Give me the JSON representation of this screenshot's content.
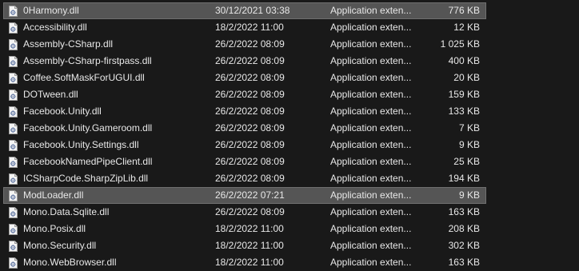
{
  "files": [
    {
      "name": "0Harmony.dll",
      "date": "30/12/2021 03:38",
      "type": "Application exten...",
      "size": "776 KB",
      "selected": true,
      "icon": "dll-file-icon"
    },
    {
      "name": "Accessibility.dll",
      "date": "18/2/2022 11:00",
      "type": "Application exten...",
      "size": "12 KB",
      "selected": false,
      "icon": "dll-file-icon"
    },
    {
      "name": "Assembly-CSharp.dll",
      "date": "26/2/2022 08:09",
      "type": "Application exten...",
      "size": "1 025 KB",
      "selected": false,
      "icon": "dll-file-icon"
    },
    {
      "name": "Assembly-CSharp-firstpass.dll",
      "date": "26/2/2022 08:09",
      "type": "Application exten...",
      "size": "400 KB",
      "selected": false,
      "icon": "dll-file-icon"
    },
    {
      "name": "Coffee.SoftMaskForUGUI.dll",
      "date": "26/2/2022 08:09",
      "type": "Application exten...",
      "size": "20 KB",
      "selected": false,
      "icon": "dll-file-icon"
    },
    {
      "name": "DOTween.dll",
      "date": "26/2/2022 08:09",
      "type": "Application exten...",
      "size": "159 KB",
      "selected": false,
      "icon": "dll-file-icon"
    },
    {
      "name": "Facebook.Unity.dll",
      "date": "26/2/2022 08:09",
      "type": "Application exten...",
      "size": "133 KB",
      "selected": false,
      "icon": "dll-file-icon"
    },
    {
      "name": "Facebook.Unity.Gameroom.dll",
      "date": "26/2/2022 08:09",
      "type": "Application exten...",
      "size": "7 KB",
      "selected": false,
      "icon": "dll-file-icon"
    },
    {
      "name": "Facebook.Unity.Settings.dll",
      "date": "26/2/2022 08:09",
      "type": "Application exten...",
      "size": "9 KB",
      "selected": false,
      "icon": "dll-file-icon"
    },
    {
      "name": "FacebookNamedPipeClient.dll",
      "date": "26/2/2022 08:09",
      "type": "Application exten...",
      "size": "25 KB",
      "selected": false,
      "icon": "dll-file-icon"
    },
    {
      "name": "ICSharpCode.SharpZipLib.dll",
      "date": "26/2/2022 08:09",
      "type": "Application exten...",
      "size": "194 KB",
      "selected": false,
      "icon": "dll-file-icon"
    },
    {
      "name": "ModLoader.dll",
      "date": "26/2/2022 07:21",
      "type": "Application exten...",
      "size": "9 KB",
      "selected": true,
      "icon": "dll-file-icon"
    },
    {
      "name": "Mono.Data.Sqlite.dll",
      "date": "26/2/2022 08:09",
      "type": "Application exten...",
      "size": "163 KB",
      "selected": false,
      "icon": "dll-file-icon"
    },
    {
      "name": "Mono.Posix.dll",
      "date": "18/2/2022 11:00",
      "type": "Application exten...",
      "size": "208 KB",
      "selected": false,
      "icon": "dll-file-icon"
    },
    {
      "name": "Mono.Security.dll",
      "date": "18/2/2022 11:00",
      "type": "Application exten...",
      "size": "302 KB",
      "selected": false,
      "icon": "dll-file-icon"
    },
    {
      "name": "Mono.WebBrowser.dll",
      "date": "18/2/2022 11:00",
      "type": "Application exten...",
      "size": "163 KB",
      "selected": false,
      "icon": "dll-file-icon"
    }
  ],
  "colors": {
    "background": "#191919",
    "text": "#e8e8e8",
    "selected_background": "#555555",
    "selected_border": "#6f6f6f"
  }
}
